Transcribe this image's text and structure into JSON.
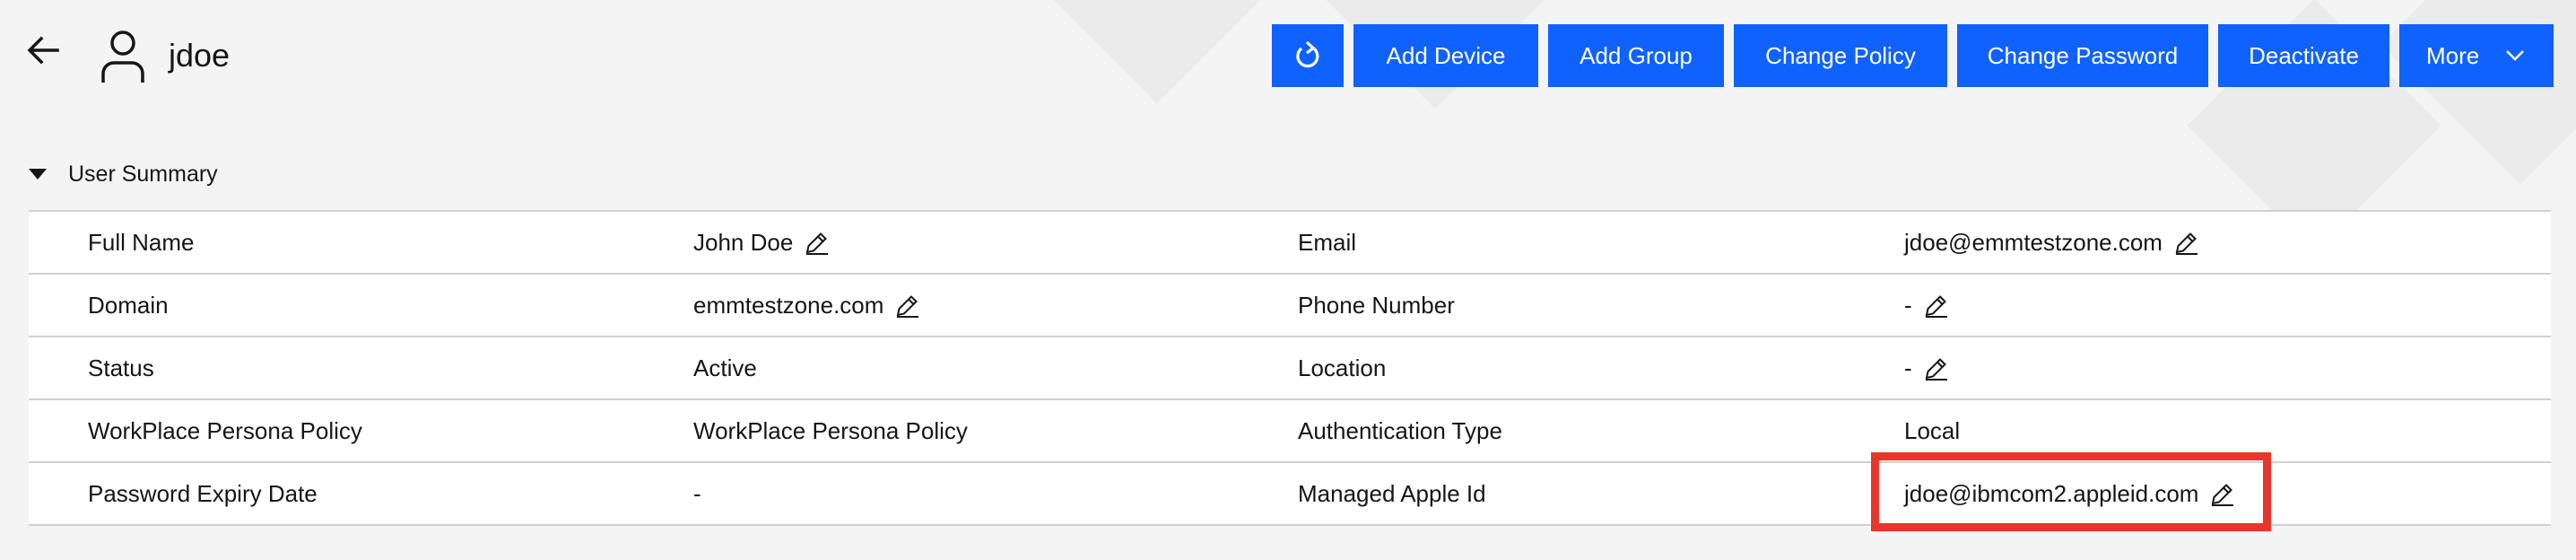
{
  "header": {
    "username": "jdoe",
    "buttons": {
      "add_device": "Add Device",
      "add_group": "Add Group",
      "change_policy": "Change Policy",
      "change_password": "Change Password",
      "deactivate": "Deactivate",
      "more": "More"
    },
    "icons": {
      "back": "arrow-left-icon",
      "user": "user-icon",
      "refresh": "refresh-icon",
      "more_chevron": "chevron-down-icon"
    }
  },
  "section": {
    "title": "User Summary",
    "expanded": true
  },
  "summary": {
    "rows": [
      {
        "label1": "Full Name",
        "value1": "John Doe",
        "label2": "Email",
        "value2": "jdoe@emmtestzone.com"
      },
      {
        "label1": "Domain",
        "value1": "emmtestzone.com",
        "label2": "Phone Number",
        "value2": "-"
      },
      {
        "label1": "Status",
        "value1": "Active",
        "label2": "Location",
        "value2": "-"
      },
      {
        "label1": "WorkPlace Persona Policy",
        "value1": "WorkPlace Persona Policy",
        "label2": "Authentication Type",
        "value2": "Local"
      },
      {
        "label1": "Password Expiry Date",
        "value1": "-",
        "label2": "Managed Apple Id",
        "value2": "jdoe@ibmcom2.appleid.com"
      }
    ]
  },
  "colors": {
    "primary_button": "#0f62fe",
    "highlight": "#e8372a",
    "background": "#f4f4f4"
  }
}
